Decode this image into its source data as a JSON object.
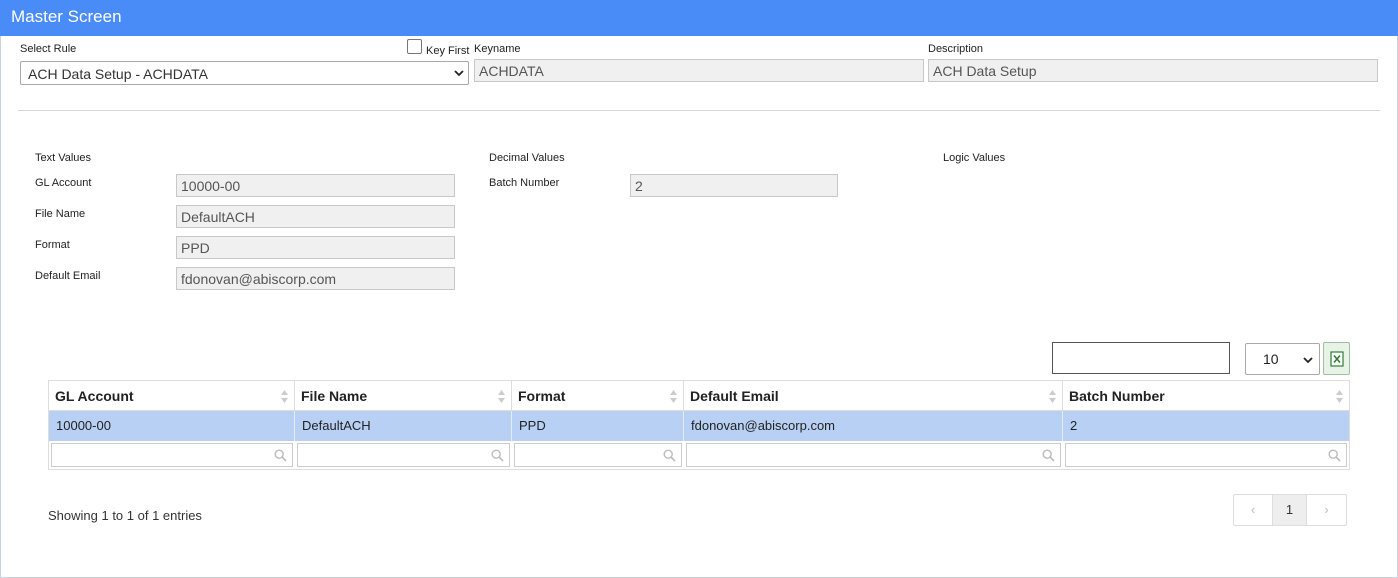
{
  "window": {
    "title": "Master Screen"
  },
  "rule": {
    "select_label": "Select Rule",
    "selected": "ACH Data Setup - ACHDATA",
    "key_first_label": "Key First",
    "keyname_label": "Keyname",
    "keyname_value": "ACHDATA",
    "description_label": "Description",
    "description_value": "ACH Data Setup"
  },
  "sections": {
    "text_values": "Text Values",
    "decimal_values": "Decimal Values",
    "logic_values": "Logic Values"
  },
  "fields": {
    "gl_account": {
      "label": "GL Account",
      "value": "10000-00"
    },
    "file_name": {
      "label": "File Name",
      "value": "DefaultACH"
    },
    "format": {
      "label": "Format",
      "value": "PPD"
    },
    "default_email": {
      "label": "Default Email",
      "value": "fdonovan@abiscorp.com"
    },
    "batch_number": {
      "label": "Batch Number",
      "value": "2"
    }
  },
  "table": {
    "page_size": "10",
    "columns": [
      "GL Account",
      "File Name",
      "Format",
      "Default Email",
      "Batch Number"
    ],
    "rows": [
      [
        "10000-00",
        "DefaultACH",
        "PPD",
        "fdonovan@abiscorp.com",
        "2"
      ]
    ],
    "showing": "Showing 1 to 1 of 1 entries",
    "pagination": {
      "prev": "‹",
      "current": "1",
      "next": "›"
    }
  },
  "icons": {
    "select_chevron": "chevron-down-icon",
    "sort": "sort-icon",
    "filter": "search-icon",
    "export": "excel-icon"
  },
  "colors": {
    "titlebar": "#4a8cf7",
    "selected_row": "#b9d0f5"
  }
}
